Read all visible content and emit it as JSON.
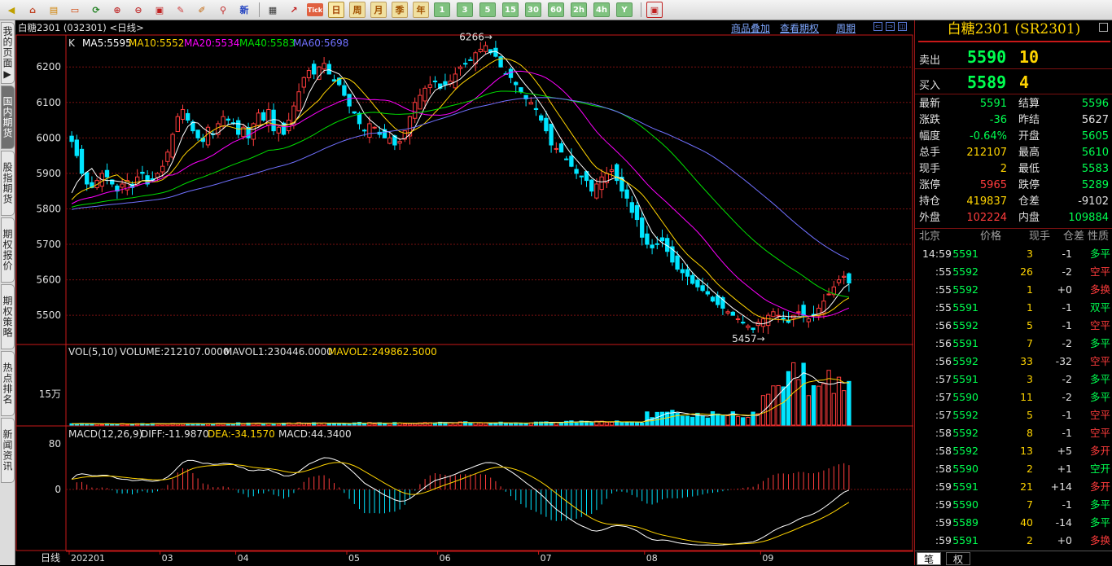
{
  "toolbar": {
    "icons": [
      "back-icon",
      "home-icon",
      "notebook-icon",
      "news-icon",
      "refresh-icon",
      "zoom-in-icon",
      "zoom-out-icon",
      "window-icon",
      "pen-icon",
      "draw-icon",
      "filter-icon",
      "new-icon"
    ],
    "new_label": "新",
    "tick_label": "Tick",
    "periods": [
      {
        "label": "日",
        "selected": true
      },
      {
        "label": "周",
        "selected": false
      },
      {
        "label": "月",
        "selected": false
      },
      {
        "label": "季",
        "selected": false
      },
      {
        "label": "年",
        "selected": false
      }
    ],
    "minutes": [
      "1",
      "3",
      "5",
      "15",
      "30",
      "60",
      "2h",
      "4h",
      "Y"
    ]
  },
  "left_tabs": [
    {
      "label": "我的页面▶",
      "active": false
    },
    {
      "label": "国内期货",
      "active": true
    },
    {
      "label": "股指期货",
      "active": false
    },
    {
      "label": "期权报价",
      "active": false
    },
    {
      "label": "期权策略",
      "active": false
    },
    {
      "label": "热点排名",
      "active": false
    },
    {
      "label": "新闻资讯",
      "active": false
    }
  ],
  "chart_header": {
    "title": "白糖2301 (032301) <日线>",
    "links": [
      "商品叠加",
      "查看期权",
      "周期"
    ]
  },
  "ma_legend": {
    "k": "K",
    "ma5": "MA5:5595",
    "ma10": "MA10:5552",
    "ma20": "MA20:5534",
    "ma40": "MA40:5583",
    "ma60": "MA60:5698"
  },
  "vol_legend": {
    "name": "VOL(5,10)",
    "volume": "VOLUME:212107.0000",
    "mavol1": "MAVOL1:230446.0000",
    "mavol2": "MAVOL2:249862.5000"
  },
  "macd_legend": {
    "name": "MACD(12,26,9)",
    "diff": "DIFF:-11.9870",
    "dea": "DEA:-34.1570",
    "macd": "MACD:44.3400"
  },
  "annotations": {
    "high": "6266→",
    "low": "5457→"
  },
  "chart_data": [
    {
      "type": "candlestick",
      "y_ticks": [
        "6200",
        "6100",
        "6000",
        "5900",
        "5800",
        "5700",
        "5600",
        "5500"
      ],
      "ylim": [
        5420,
        6290
      ],
      "x_axis_label": "日线",
      "x_ticks": [
        "202201",
        "03",
        "04",
        "05",
        "06",
        "07",
        "08",
        "09"
      ],
      "colors": {
        "up": "#ff3c3c",
        "down": "#00e5ff",
        "ma5": "#ffffff",
        "ma10": "#ffd400",
        "ma20": "#ff00ff",
        "ma40": "#00e000",
        "ma60": "#7070ff"
      },
      "closes_by_month": [
        {
          "month": "202201",
          "closes": [
            5990,
            5950,
            5900,
            5870,
            5860,
            5880,
            5900,
            5890,
            5870,
            5850,
            5870,
            5880,
            5860,
            5890,
            5900,
            5870,
            5880,
            5900
          ]
        },
        {
          "month": "02",
          "closes": [
            5920,
            5960,
            6010,
            6060,
            6080,
            6050,
            6020,
            6000,
            5990,
            6030,
            6010,
            6040,
            6060,
            6050,
            6040
          ]
        },
        {
          "month": "03",
          "closes": [
            6010,
            6030,
            6000,
            6040,
            6070,
            6050,
            6080,
            6020,
            6030,
            6010,
            6050,
            6090,
            6130,
            6170,
            6190,
            6180,
            6200,
            6210,
            6180,
            6160,
            6150,
            6120
          ]
        },
        {
          "month": "04",
          "closes": [
            6090,
            6070,
            6040,
            6020,
            6040,
            6030,
            6010,
            6000,
            6000,
            5980,
            5990,
            6020,
            6060,
            6100,
            6120,
            6140,
            6150,
            6160
          ]
        },
        {
          "month": "05",
          "closes": [
            6140,
            6150,
            6160,
            6180,
            6200,
            6210,
            6220,
            6240,
            6250,
            6260,
            6240,
            6230,
            6200,
            6180,
            6170,
            6150,
            6130,
            6110,
            6100,
            6080
          ]
        },
        {
          "month": "06",
          "closes": [
            6050,
            6020,
            5980,
            5970,
            5960,
            5940,
            5920,
            5900,
            5890,
            5880,
            5850,
            5870,
            5890,
            5900,
            5910,
            5880,
            5850,
            5830,
            5790,
            5770,
            5720
          ]
        },
        {
          "month": "07",
          "closes": [
            5700,
            5690,
            5700,
            5710,
            5680,
            5650,
            5630,
            5620,
            5610,
            5590,
            5580,
            5570,
            5560,
            5540,
            5530,
            5520,
            5510,
            5500,
            5490,
            5480,
            5470,
            5460,
            5480
          ]
        },
        {
          "month": "08",
          "closes": [
            5490,
            5500,
            5510,
            5500,
            5490,
            5480,
            5500,
            5510,
            5500,
            5490,
            5500,
            5520,
            5540,
            5560,
            5580,
            5600,
            5610,
            5591
          ]
        }
      ],
      "last_close": 5591,
      "high_mark": 6266,
      "low_mark": 5457
    },
    {
      "type": "bar",
      "name": "VOL(5,10)",
      "y_ticks": [
        "15万"
      ],
      "volume_by_month_in_wan": [
        {
          "month": "202201",
          "avg": 0.6
        },
        {
          "month": "02",
          "avg": 0.7
        },
        {
          "month": "03",
          "avg": 0.9
        },
        {
          "month": "04",
          "avg": 1.0
        },
        {
          "month": "05",
          "avg": 1.2
        },
        {
          "month": "06",
          "avg": 1.5
        },
        {
          "month": "07",
          "avg": 5.5
        },
        {
          "month": "08",
          "avg": 22.0
        }
      ],
      "last_volume": 212107
    },
    {
      "type": "bar",
      "name": "MACD(12,26,9)",
      "y_ticks": [
        "80",
        "0"
      ],
      "diff": -11.987,
      "dea": -34.157,
      "macd": 44.34
    }
  ],
  "quote": {
    "title": "白糖2301 (SR2301)",
    "sell_label": "卖出",
    "sell_price": "5590",
    "sell_vol": "10",
    "buy_label": "买入",
    "buy_price": "5589",
    "buy_vol": "4",
    "stats": [
      {
        "l1": "最新",
        "v1": "5591",
        "c1": "grn",
        "l2": "结算",
        "v2": "5596",
        "c2": "grn"
      },
      {
        "l1": "涨跌",
        "v1": "-36",
        "c1": "grn",
        "l2": "昨结",
        "v2": "5627",
        "c2": "wht"
      },
      {
        "l1": "幅度",
        "v1": "-0.64%",
        "c1": "grn",
        "l2": "开盘",
        "v2": "5605",
        "c2": "grn"
      },
      {
        "l1": "总手",
        "v1": "212107",
        "c1": "yel",
        "l2": "最高",
        "v2": "5610",
        "c2": "grn"
      },
      {
        "l1": "现手",
        "v1": "2",
        "c1": "yel",
        "l2": "最低",
        "v2": "5583",
        "c2": "grn"
      },
      {
        "l1": "涨停",
        "v1": "5965",
        "c1": "red",
        "l2": "跌停",
        "v2": "5289",
        "c2": "grn"
      },
      {
        "l1": "持仓",
        "v1": "419837",
        "c1": "yel",
        "l2": "仓差",
        "v2": "-9102",
        "c2": "wht"
      },
      {
        "l1": "外盘",
        "v1": "102224",
        "c1": "red",
        "l2": "内盘",
        "v2": "109884",
        "c2": "grn"
      }
    ],
    "tick_headers": [
      "北京",
      "价格",
      "现手",
      "仓差",
      "性质"
    ],
    "ticks": [
      {
        "t": "14:59",
        "p": "5591",
        "q": "3",
        "c": "-1",
        "n": "多平",
        "pc": "grn",
        "nc": "grn"
      },
      {
        "t": ":55",
        "p": "5592",
        "q": "26",
        "c": "-2",
        "n": "空平",
        "pc": "grn",
        "nc": "red"
      },
      {
        "t": ":55",
        "p": "5592",
        "q": "1",
        "c": "+0",
        "n": "多换",
        "pc": "grn",
        "nc": "red"
      },
      {
        "t": ":55",
        "p": "5591",
        "q": "1",
        "c": "-1",
        "n": "双平",
        "pc": "grn",
        "nc": "grn"
      },
      {
        "t": ":56",
        "p": "5592",
        "q": "5",
        "c": "-1",
        "n": "空平",
        "pc": "grn",
        "nc": "red"
      },
      {
        "t": ":56",
        "p": "5591",
        "q": "7",
        "c": "-2",
        "n": "多平",
        "pc": "grn",
        "nc": "grn"
      },
      {
        "t": ":56",
        "p": "5592",
        "q": "33",
        "c": "-32",
        "n": "空平",
        "pc": "grn",
        "nc": "red"
      },
      {
        "t": ":57",
        "p": "5591",
        "q": "3",
        "c": "-2",
        "n": "多平",
        "pc": "grn",
        "nc": "grn"
      },
      {
        "t": ":57",
        "p": "5590",
        "q": "11",
        "c": "-2",
        "n": "多平",
        "pc": "grn",
        "nc": "grn"
      },
      {
        "t": ":57",
        "p": "5592",
        "q": "5",
        "c": "-1",
        "n": "空平",
        "pc": "grn",
        "nc": "red"
      },
      {
        "t": ":58",
        "p": "5592",
        "q": "8",
        "c": "-1",
        "n": "空平",
        "pc": "grn",
        "nc": "red"
      },
      {
        "t": ":58",
        "p": "5592",
        "q": "13",
        "c": "+5",
        "n": "多开",
        "pc": "grn",
        "nc": "red"
      },
      {
        "t": ":58",
        "p": "5590",
        "q": "2",
        "c": "+1",
        "n": "空开",
        "pc": "grn",
        "nc": "grn"
      },
      {
        "t": ":59",
        "p": "5591",
        "q": "21",
        "c": "+14",
        "n": "多开",
        "pc": "grn",
        "nc": "red"
      },
      {
        "t": ":59",
        "p": "5590",
        "q": "7",
        "c": "-1",
        "n": "多平",
        "pc": "grn",
        "nc": "grn"
      },
      {
        "t": ":59",
        "p": "5589",
        "q": "40",
        "c": "-14",
        "n": "多平",
        "pc": "grn",
        "nc": "grn"
      },
      {
        "t": ":59",
        "p": "5591",
        "q": "2",
        "c": "+0",
        "n": "多换",
        "pc": "grn",
        "nc": "red"
      }
    ],
    "bottom_tabs": [
      "笔",
      "权"
    ]
  }
}
